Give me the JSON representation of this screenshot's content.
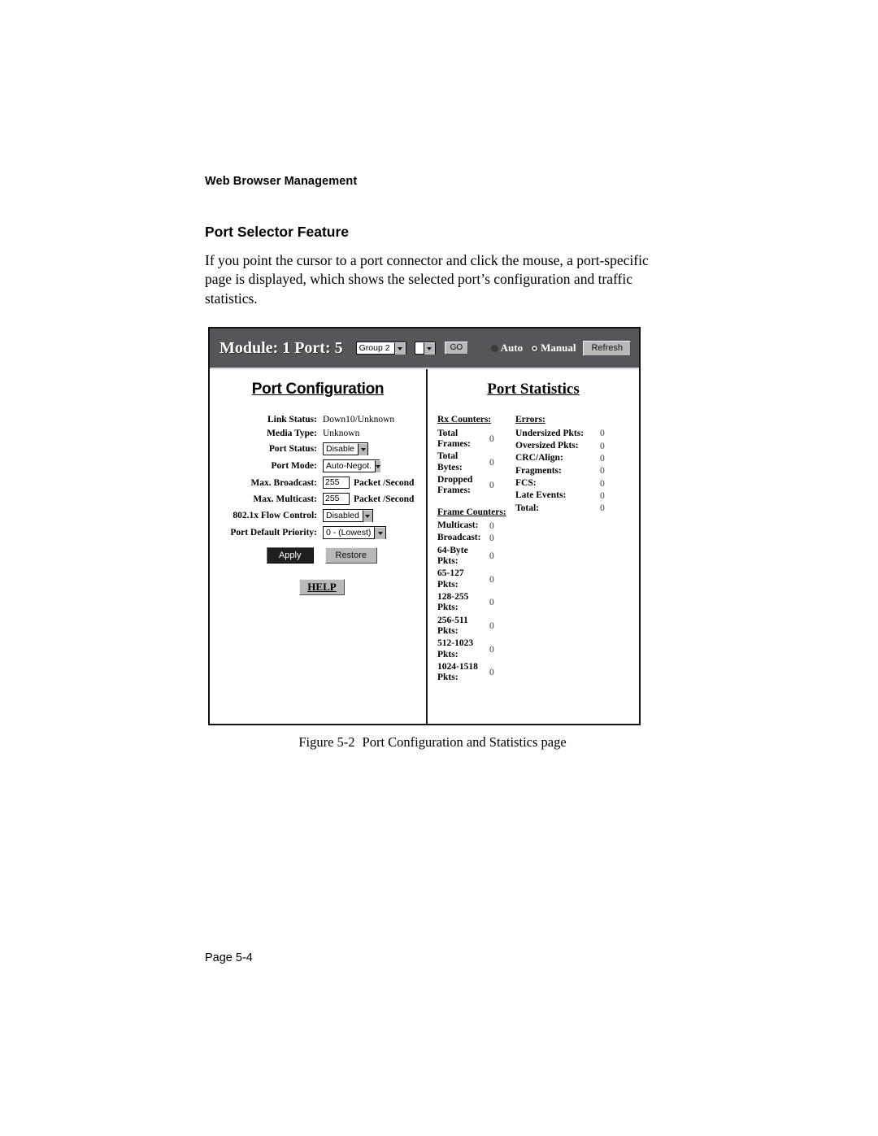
{
  "document": {
    "running_head": "Web Browser Management",
    "section_title": "Port Selector Feature",
    "paragraph": "If you point the cursor to a port connector and click the mouse, a port-specific page is displayed, which shows the selected port’s configuration and traffic statistics.",
    "figure_number": "Figure 5-2",
    "figure_caption": "Port Configuration and Statistics page",
    "footer": "Page 5-4"
  },
  "screenshot": {
    "header": {
      "title": "Module: 1   Port: 5",
      "group_select": "Group 2",
      "port_select": "",
      "go_button": "GO",
      "auto_label": "Auto",
      "manual_label": "Manual",
      "refresh_button": "Refresh",
      "selected_mode": "Auto",
      "bar_color": "#56565a"
    },
    "port_configuration": {
      "heading": "Port Configuration",
      "fields": [
        {
          "label": "Link Status:",
          "value": "Down10/Unknown",
          "type": "text"
        },
        {
          "label": "Media Type:",
          "value": "Unknown",
          "type": "text"
        },
        {
          "label": "Port Status:",
          "value": "Disable",
          "type": "select"
        },
        {
          "label": "Port Mode:",
          "value": "Auto-Negot.",
          "type": "select"
        },
        {
          "label": "Max. Broadcast:",
          "value": "255",
          "type": "input",
          "unit": "Packet /Second"
        },
        {
          "label": "Max. Multicast:",
          "value": "255",
          "type": "input",
          "unit": "Packet /Second"
        },
        {
          "label": "802.1x Flow Control:",
          "value": "Disabled",
          "type": "select"
        },
        {
          "label": "Port Default Priority:",
          "value": "0 - (Lowest)",
          "type": "select"
        }
      ],
      "apply_button": "Apply",
      "restore_button": "Restore",
      "help_button": "HELP"
    },
    "port_statistics": {
      "heading": "Port Statistics",
      "rx_counters": {
        "title": "Rx Counters:",
        "rows": [
          {
            "name": "Total Frames:",
            "value": "0"
          },
          {
            "name": "Total Bytes:",
            "value": "0"
          },
          {
            "name": "Dropped Frames:",
            "value": "0"
          }
        ]
      },
      "frame_counters": {
        "title": "Frame Counters:",
        "rows": [
          {
            "name": "Multicast:",
            "value": "0"
          },
          {
            "name": "Broadcast:",
            "value": "0"
          },
          {
            "name": "64-Byte Pkts:",
            "value": "0"
          },
          {
            "name": "65-127 Pkts:",
            "value": "0"
          },
          {
            "name": "128-255 Pkts:",
            "value": "0"
          },
          {
            "name": "256-511 Pkts:",
            "value": "0"
          },
          {
            "name": "512-1023 Pkts:",
            "value": "0"
          },
          {
            "name": "1024-1518 Pkts:",
            "value": "0"
          }
        ]
      },
      "errors": {
        "title": "Errors:",
        "rows": [
          {
            "name": "Undersized Pkts:",
            "value": "0"
          },
          {
            "name": "Oversized Pkts:",
            "value": "0"
          },
          {
            "name": "CRC/Align:",
            "value": "0"
          },
          {
            "name": "Fragments:",
            "value": "0"
          },
          {
            "name": "FCS:",
            "value": "0"
          },
          {
            "name": "Late Events:",
            "value": "0"
          },
          {
            "name": "Total:",
            "value": "0"
          }
        ]
      }
    }
  }
}
